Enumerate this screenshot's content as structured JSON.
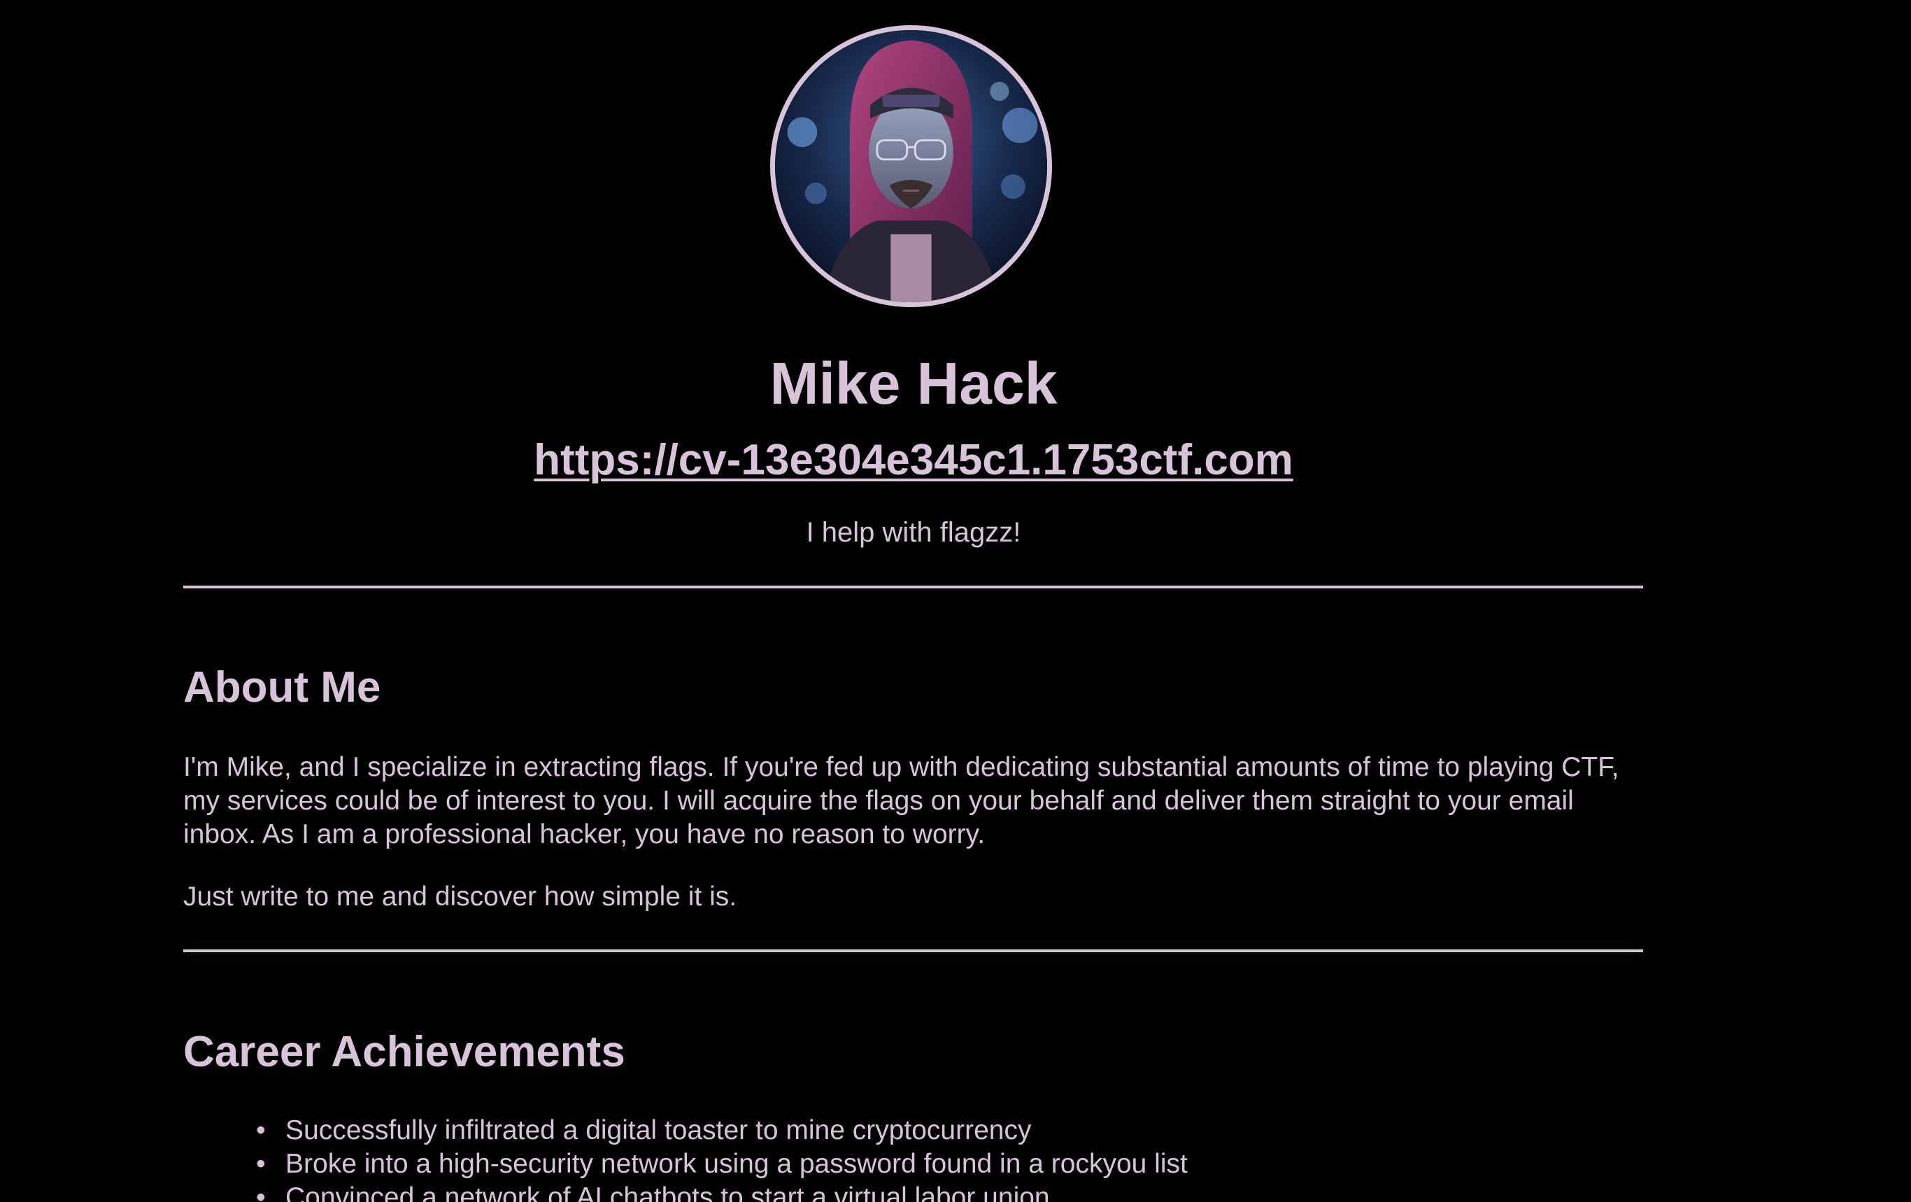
{
  "profile": {
    "avatar_alt": "Profile photo",
    "name": "Mike Hack",
    "url": "https://cv-13e304e345c1.1753ctf.com",
    "tagline": "I help with flagzz!"
  },
  "about": {
    "title": "About Me",
    "paragraphs": [
      "I'm Mike, and I specialize in extracting flags. If you're fed up with dedicating substantial amounts of time to playing CTF, my services could be of interest to you. I will acquire the flags on your behalf and deliver them straight to your email inbox. As I am a professional hacker, you have no reason to worry.",
      "Just write to me and discover how simple it is."
    ]
  },
  "career": {
    "title": "Career Achievements",
    "items": [
      "Successfully infiltrated a digital toaster to mine cryptocurrency",
      "Broke into a high-security network using a password found in a rockyou list",
      "Convinced a network of AI chatbots to start a virtual labor union"
    ]
  },
  "colors": {
    "background": "#000000",
    "text": "#d8c3db",
    "accent": "#d8c3db"
  }
}
